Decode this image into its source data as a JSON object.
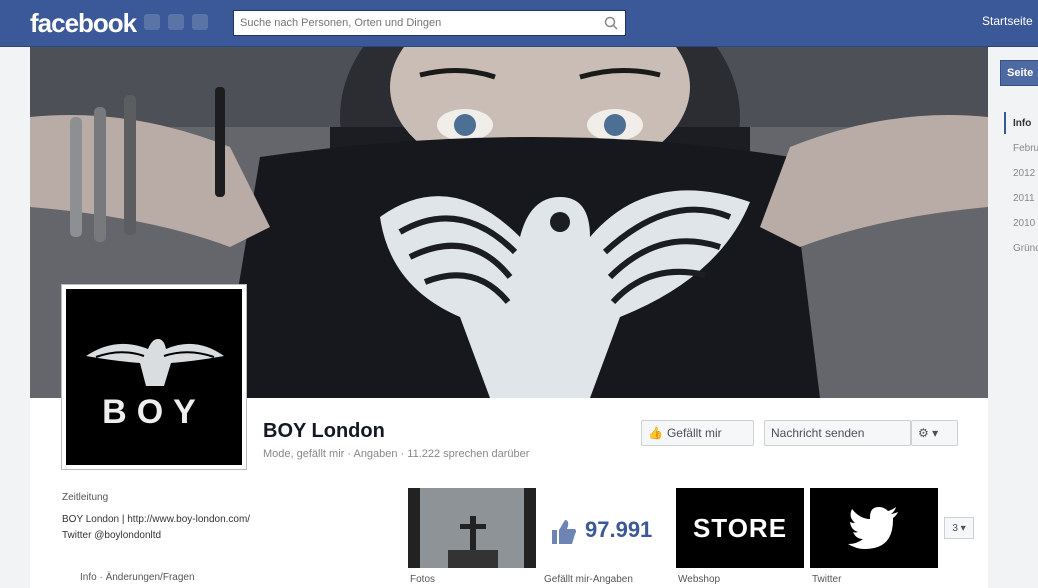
{
  "topbar": {
    "logo": "facebook",
    "search_placeholder": "Suche nach Personen, Orten und Dingen",
    "user_label": "Startseite"
  },
  "cover": {
    "description_colors": {
      "hand": "#c7bdb8",
      "hair": "#1d1f24",
      "mask": "#1a1c22",
      "eagle": "#e6ecef"
    }
  },
  "page": {
    "name": "BOY London",
    "subtitle": "Mode, gefällt mir · Angaben · 11.222 sprechen darüber",
    "profile_text": "BOY"
  },
  "actions": {
    "like": "Gefällt mir",
    "message": "Nachricht senden",
    "gear": "⚙ ▾"
  },
  "about": {
    "title": "Zeitleitung",
    "line1": "BOY London | http://www.boy-london.com/",
    "line2": "Twitter @boylondonltd",
    "link": "Info · Änderungen/Fragen"
  },
  "apps": {
    "likes_count": "97.991",
    "store": "STORE",
    "more": "3 ▾",
    "labels": [
      "Fotos",
      "Gefällt mir-Angaben",
      "Webshop",
      "Twitter"
    ]
  },
  "sidebar": {
    "button": "Seite",
    "items": [
      "Info",
      "Februar",
      "2012",
      "2011",
      "2010",
      "Gründung"
    ]
  }
}
